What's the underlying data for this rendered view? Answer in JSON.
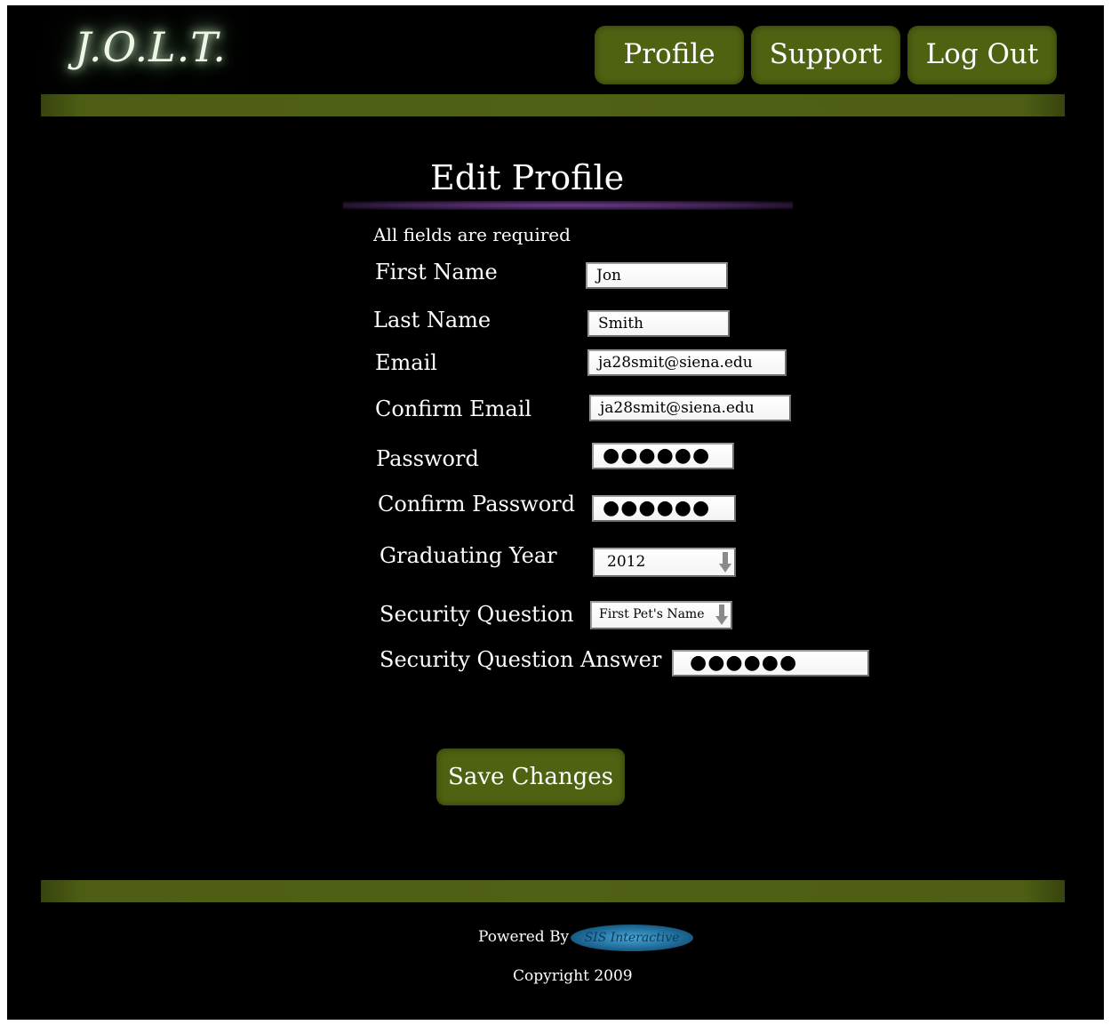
{
  "header": {
    "logo": "J.O.L.T.",
    "nav": [
      {
        "label": "Profile"
      },
      {
        "label": "Support"
      },
      {
        "label": "Log Out"
      }
    ]
  },
  "form": {
    "title": "Edit Profile",
    "note": "All fields are required",
    "fields": {
      "first_name": {
        "label": "First Name",
        "value": "Jon"
      },
      "last_name": {
        "label": "Last Name",
        "value": "Smith"
      },
      "email": {
        "label": "Email",
        "value": "ja28smit@siena.edu"
      },
      "confirm_email": {
        "label": "Confirm Email",
        "value": "ja28smit@siena.edu"
      },
      "password": {
        "label": "Password",
        "value": "●●●●●●"
      },
      "confirm_password": {
        "label": "Confirm Password",
        "value": "●●●●●●"
      },
      "graduating_year": {
        "label": "Graduating Year",
        "value": "2012"
      },
      "security_question": {
        "label": "Security Question",
        "value": "First Pet's Name"
      },
      "security_answer": {
        "label": "Security Question Answer",
        "value": "●●●●●●"
      }
    },
    "save_label": "Save Changes"
  },
  "footer": {
    "powered_by": "Powered By",
    "badge_text": "SIS Interactive",
    "copyright": "Copyright 2009"
  },
  "colors": {
    "background": "#000000",
    "accent_green": "#4f6212",
    "text": "#ffffff",
    "title_rule": "#6a3b8a"
  }
}
